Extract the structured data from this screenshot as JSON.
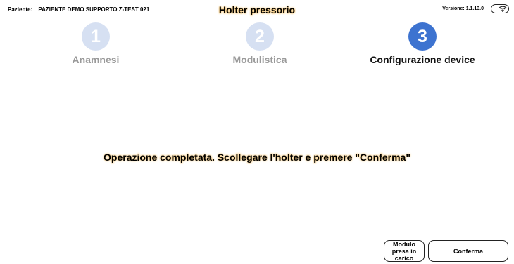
{
  "header": {
    "patient_label": "Paziente:",
    "patient_name": "PAZIENTE DEMO SUPPORTO Z-TEST 021",
    "title": "Holter pressorio",
    "version": "Versione: 1.1.13.0",
    "connection_icon": "wifi-icon"
  },
  "steps": [
    {
      "number": "1",
      "label": "Anamnesi",
      "state": "done"
    },
    {
      "number": "2",
      "label": "Modulistica",
      "state": "done"
    },
    {
      "number": "3",
      "label": "Configurazione device",
      "state": "active"
    }
  ],
  "main": {
    "message": "Operazione completata. Scollegare l'holter e premere \"Conferma\""
  },
  "footer": {
    "modulo_label": "Modulo presa in carico",
    "confirm_label": "Conferma"
  },
  "colors": {
    "step_done": "#d6e0f2",
    "step_active": "#3d73d0",
    "step_label_done": "#9a9a9a",
    "title_glow": "#f4c26b"
  }
}
